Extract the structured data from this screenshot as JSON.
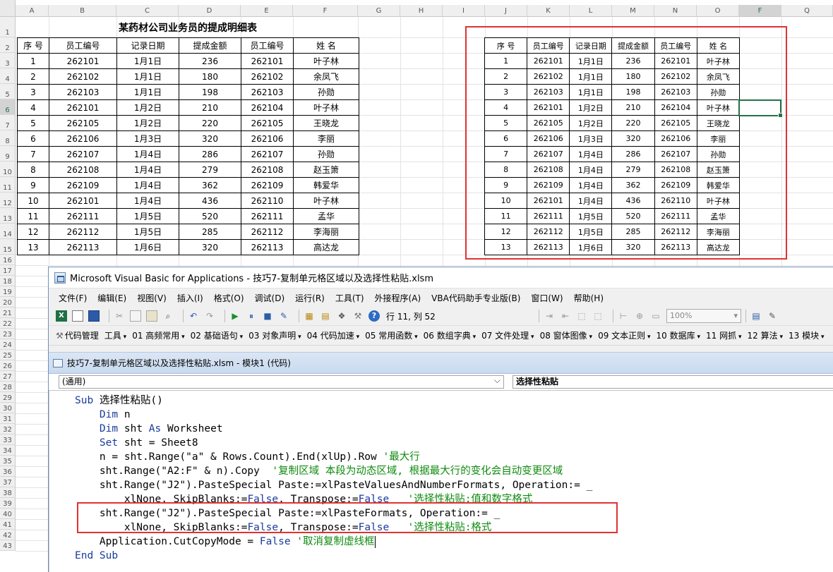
{
  "columns": [
    "A",
    "B",
    "C",
    "D",
    "E",
    "F",
    "G",
    "H",
    "I",
    "J",
    "K",
    "L",
    "M",
    "N",
    "O",
    "F",
    "Q"
  ],
  "rows": [
    "1",
    "2",
    "3",
    "4",
    "5",
    "6",
    "7",
    "8",
    "9",
    "10",
    "11",
    "12",
    "13",
    "14",
    "15",
    "16",
    "17",
    "18",
    "19",
    "20",
    "21",
    "22",
    "23",
    "24",
    "25",
    "26",
    "27",
    "28",
    "29",
    "30",
    "31",
    "32",
    "33",
    "34",
    "35",
    "36",
    "37",
    "38",
    "39",
    "40",
    "41",
    "42",
    "43"
  ],
  "sheet": {
    "title": "某药材公司业务员的提成明细表",
    "headers": [
      "序 号",
      "员工编号",
      "记录日期",
      "提成金额",
      "员工编号",
      "姓 名"
    ],
    "table": [
      [
        "1",
        "262101",
        "1月1日",
        "236",
        "262101",
        "叶子林"
      ],
      [
        "2",
        "262102",
        "1月1日",
        "180",
        "262102",
        "余凤飞"
      ],
      [
        "3",
        "262103",
        "1月1日",
        "198",
        "262103",
        "孙勋"
      ],
      [
        "4",
        "262101",
        "1月2日",
        "210",
        "262104",
        "叶子林"
      ],
      [
        "5",
        "262105",
        "1月2日",
        "220",
        "262105",
        "王晓龙"
      ],
      [
        "6",
        "262106",
        "1月3日",
        "320",
        "262106",
        "李丽"
      ],
      [
        "7",
        "262107",
        "1月4日",
        "286",
        "262107",
        "孙勋"
      ],
      [
        "8",
        "262108",
        "1月4日",
        "279",
        "262108",
        "赵玉箫"
      ],
      [
        "9",
        "262109",
        "1月4日",
        "362",
        "262109",
        "韩爱华"
      ],
      [
        "10",
        "262101",
        "1月4日",
        "436",
        "262110",
        "叶子林"
      ],
      [
        "11",
        "262111",
        "1月5日",
        "520",
        "262111",
        "孟华"
      ],
      [
        "12",
        "262112",
        "1月5日",
        "285",
        "262112",
        "李海丽"
      ],
      [
        "13",
        "262113",
        "1月6日",
        "320",
        "262113",
        "高达龙"
      ]
    ]
  },
  "vbe": {
    "title": "Microsoft Visual Basic for Applications - 技巧7-复制单元格区域以及选择性粘贴.xlsm",
    "menu": [
      "文件(F)",
      "编辑(E)",
      "视图(V)",
      "插入(I)",
      "格式(O)",
      "调试(D)",
      "运行(R)",
      "工具(T)",
      "外接程序(A)",
      "VBA代码助手专业版(B)",
      "窗口(W)",
      "帮助(H)"
    ],
    "rowcol": "行 11, 列 52",
    "zoom": "100%",
    "toolbar2": [
      "代码管理",
      "工具",
      "01 高频常用",
      "02 基础语句",
      "03 对象声明",
      "04 代码加速",
      "05 常用函数",
      "06 数组字典",
      "07 文件处理",
      "08 窗体图像",
      "09 文本正则",
      "10 数据库",
      "11 网抓",
      "12 算法",
      "13 模块"
    ],
    "code_window_title": "技巧7-复制单元格区域以及选择性粘贴.xlsm - 模块1 (代码)",
    "combo_left": "(通用)",
    "combo_right": "选择性粘贴",
    "code": [
      {
        "indent": "",
        "p": [
          [
            "k",
            "Sub"
          ],
          [
            "t",
            " 选择性粘贴()"
          ]
        ]
      },
      {
        "indent": "    ",
        "p": [
          [
            "k",
            "Dim"
          ],
          [
            "t",
            " n"
          ]
        ]
      },
      {
        "indent": "    ",
        "p": [
          [
            "k",
            "Dim"
          ],
          [
            "t",
            " sht "
          ],
          [
            "k",
            "As"
          ],
          [
            "t",
            " Worksheet"
          ]
        ]
      },
      {
        "indent": "    ",
        "p": [
          [
            "k",
            "Set"
          ],
          [
            "t",
            " sht = Sheet8"
          ]
        ]
      },
      {
        "indent": "    ",
        "p": [
          [
            "t",
            "n = sht.Range(\"a\" & Rows.Count).End(xlUp).Row "
          ],
          [
            "c",
            "'最大行"
          ]
        ]
      },
      {
        "indent": "    ",
        "p": [
          [
            "t",
            "sht.Range(\"A2:F\" & n).Copy  "
          ],
          [
            "c",
            "'复制区域 本段为动态区域, 根据最大行的变化会自动变更区域"
          ]
        ]
      },
      {
        "indent": "    ",
        "p": [
          [
            "t",
            "sht.Range(\"J2\").PasteSpecial Paste:=xlPasteValuesAndNumberFormats, Operation:= _"
          ]
        ]
      },
      {
        "indent": "        ",
        "p": [
          [
            "t",
            "xlNone, SkipBlanks:="
          ],
          [
            "k",
            "False"
          ],
          [
            "t",
            ", Transpose:="
          ],
          [
            "k",
            "False"
          ],
          [
            "t",
            "   "
          ],
          [
            "c",
            "'选择性粘贴:值和数字格式"
          ]
        ]
      },
      {
        "indent": "    ",
        "p": [
          [
            "t",
            "sht.Range(\"J2\").PasteSpecial Paste:=xlPasteFormats, Operation:= _"
          ]
        ]
      },
      {
        "indent": "        ",
        "p": [
          [
            "t",
            "xlNone, SkipBlanks:="
          ],
          [
            "k",
            "False"
          ],
          [
            "t",
            ", Transpose:="
          ],
          [
            "k",
            "False"
          ],
          [
            "t",
            "   "
          ],
          [
            "c",
            "'选择性粘贴:格式"
          ]
        ]
      },
      {
        "indent": "    ",
        "p": [
          [
            "t",
            "Application.CutCopyMode = "
          ],
          [
            "k",
            "False"
          ],
          [
            "t",
            " "
          ],
          [
            "c",
            "'取消复制虚线框"
          ]
        ]
      },
      {
        "indent": "",
        "p": [
          [
            "k",
            "End Sub"
          ]
        ]
      }
    ]
  }
}
